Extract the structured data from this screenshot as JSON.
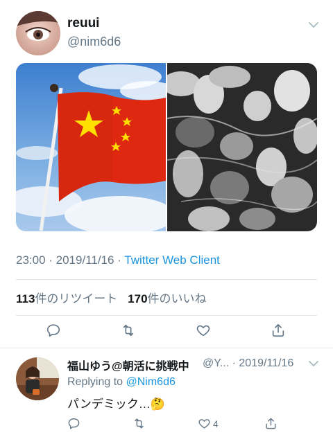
{
  "tweet": {
    "display_name": "reuui",
    "handle": "@nim6d6",
    "timestamp": "23:00 · 2019/11/16 · ",
    "client": "Twitter Web Client",
    "retweet_count": "113",
    "retweet_label": "件のリツイート",
    "like_count": "170",
    "like_label": "件のいいね"
  },
  "reply": {
    "display_name": "福山ゆう@朝活に挑戦中",
    "handle_date": "@Y... · 2019/11/16",
    "replying_prefix": "Replying to ",
    "replying_handle": "@Nim6d6",
    "text": "パンデミック…🤔",
    "like_count": "4"
  },
  "colors": {
    "link": "#1b95e0",
    "muted": "#657786",
    "divider": "#e1e8ed",
    "flag_red": "#de2910",
    "flag_yellow": "#ffde00"
  }
}
